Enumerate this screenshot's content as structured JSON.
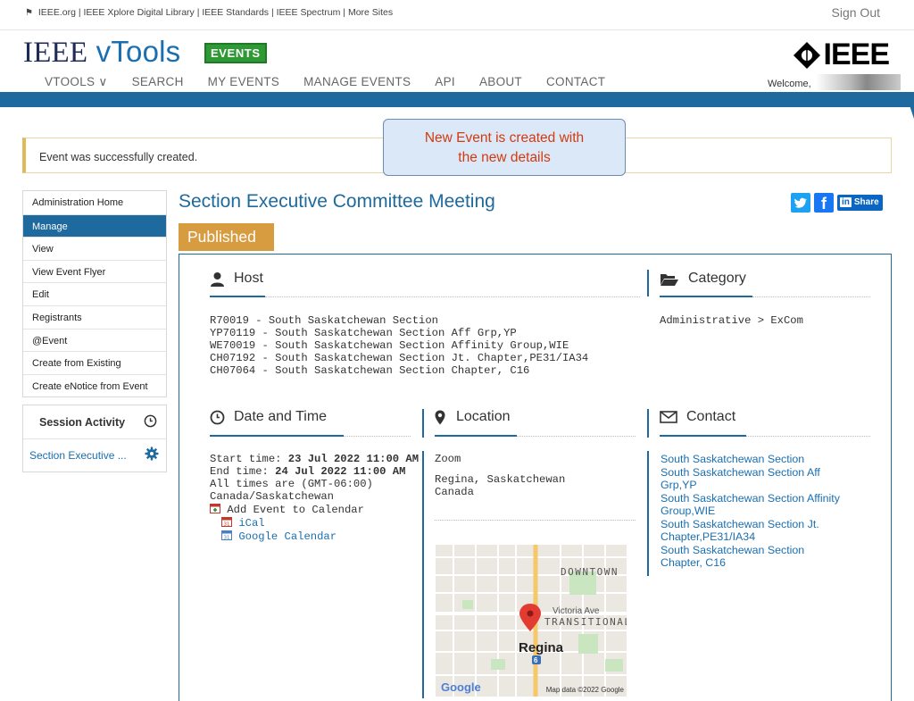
{
  "topbar": {
    "links": "IEEE.org | IEEE Xplore Digital Library | IEEE Standards | IEEE Spectrum | More Sites",
    "sign_out": "Sign Out"
  },
  "brand": {
    "ieee": "IEEE",
    "vtools": "vTools",
    "badge": "EVENTS",
    "logo_word": "IEEE"
  },
  "nav": {
    "items": [
      "VTOOLS ∨",
      "SEARCH",
      "MY EVENTS",
      "MANAGE EVENTS",
      "API",
      "ABOUT",
      "CONTACT"
    ],
    "active": "MANAGE EVENTS",
    "welcome": "Welcome,"
  },
  "alert": {
    "message": "Event was successfully created.",
    "callout_line1": "New Event is created with",
    "callout_line2": "the new details"
  },
  "sidebar": {
    "items": [
      "Administration Home",
      "Manage",
      "View",
      "View Event Flyer",
      "Edit",
      "Registrants",
      "@Event",
      "Create from Existing",
      "Create eNotice from Event"
    ],
    "active_index": 1,
    "session_title": "Session Activity",
    "session_item": "Section Executive ..."
  },
  "event": {
    "title": "Section Executive Committee Meeting",
    "status": "Published",
    "share": "Share"
  },
  "host": {
    "heading": "Host",
    "lines": [
      "R70019 - South Saskatchewan Section",
      "YP70119 - South Saskatchewan Section Aff Grp,YP",
      "WE70019 - South Saskatchewan Section Affinity Group,WIE",
      "CH07192 - South Saskatchewan Section Jt. Chapter,PE31/IA34",
      "CH07064 - South Saskatchewan Section Chapter, C16"
    ]
  },
  "category": {
    "heading": "Category",
    "value": "Administrative > ExCom"
  },
  "datetime": {
    "heading": "Date and Time",
    "start_label": "Start time:",
    "start_value": "23 Jul 2022 11:00 AM",
    "end_label": "End time:",
    "end_value": "24 Jul 2022 11:00 AM",
    "tz_line1": "All times are (GMT-06:00)",
    "tz_line2": "Canada/Saskatchewan",
    "add_calendar": "Add Event to Calendar",
    "ical": "iCal",
    "google": "Google Calendar"
  },
  "location": {
    "heading": "Location",
    "type": "Zoom",
    "city": "Regina, Saskatchewan",
    "country": "Canada",
    "map_labels": {
      "downtown": "DOWNTOWN",
      "street": "Victoria Ave",
      "transitional": "TRANSITIONAL",
      "city": "Regina",
      "route": "6",
      "google": "Google",
      "attribution": "Map data ©2022 Google"
    }
  },
  "contact": {
    "heading": "Contact",
    "lines": [
      "South Saskatchewan Section",
      "South Saskatchewan Section Aff",
      "Grp,YP",
      "South Saskatchewan Section Affinity",
      "Group,WIE",
      "South Saskatchewan Section Jt.",
      "Chapter,PE31/IA34",
      "South Saskatchewan Section",
      "Chapter, C16"
    ]
  },
  "colors": {
    "primary": "#1e6a9e",
    "link": "#1a6fb1",
    "published": "#d79b40",
    "events_badge": "#2f9a35",
    "callout_text": "#d23a10"
  }
}
